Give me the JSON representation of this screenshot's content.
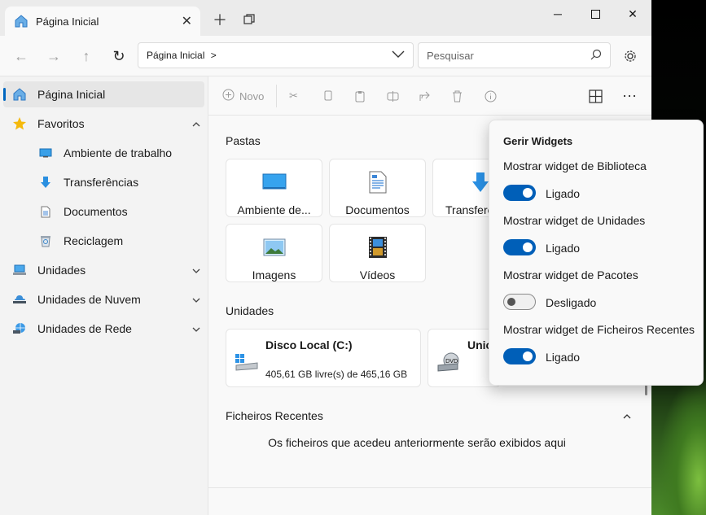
{
  "tab": {
    "title": "Página Inicial"
  },
  "address": {
    "crumb": "Página Inicial",
    "separator": ">"
  },
  "search": {
    "placeholder": "Pesquisar"
  },
  "sidebar": {
    "items": [
      {
        "label": "Página Inicial",
        "icon": "home-icon"
      },
      {
        "label": "Favoritos",
        "icon": "star-icon"
      },
      {
        "label": "Ambiente de trabalho",
        "icon": "desktop-icon"
      },
      {
        "label": "Transferências",
        "icon": "download-icon"
      },
      {
        "label": "Documentos",
        "icon": "document-icon"
      },
      {
        "label": "Reciclagem",
        "icon": "recycle-bin-icon"
      },
      {
        "label": "Unidades",
        "icon": "drives-icon"
      },
      {
        "label": "Unidades de Nuvem",
        "icon": "cloud-drive-icon"
      },
      {
        "label": "Unidades de Rede",
        "icon": "network-icon"
      }
    ]
  },
  "command_bar": {
    "new_label": "Novo"
  },
  "folders": {
    "title": "Pastas",
    "items": [
      {
        "label": "Ambiente de..."
      },
      {
        "label": "Documentos"
      },
      {
        "label": "Transferê"
      },
      {
        "label": "Imagens"
      },
      {
        "label": "Vídeos"
      }
    ]
  },
  "drives": {
    "title": "Unidades",
    "items": [
      {
        "name": "Disco Local (C:)",
        "space": "405,61 GB livre(s) de 465,16 GB"
      },
      {
        "name": "Unic",
        "space": ""
      }
    ]
  },
  "recent": {
    "title": "Ficheiros Recentes",
    "empty": "Os ficheiros que acedeu anteriormente serão exibidos aqui"
  },
  "widgets": {
    "title": "Gerir Widgets",
    "options": [
      {
        "label": "Mostrar widget de Biblioteca",
        "state": "Ligado",
        "on": true
      },
      {
        "label": "Mostrar widget de Unidades",
        "state": "Ligado",
        "on": true
      },
      {
        "label": "Mostrar widget de Pacotes",
        "state": "Desligado",
        "on": false
      },
      {
        "label": "Mostrar widget de Ficheiros Recentes",
        "state": "Ligado",
        "on": true
      }
    ]
  },
  "colors": {
    "accent": "#005fb8"
  }
}
